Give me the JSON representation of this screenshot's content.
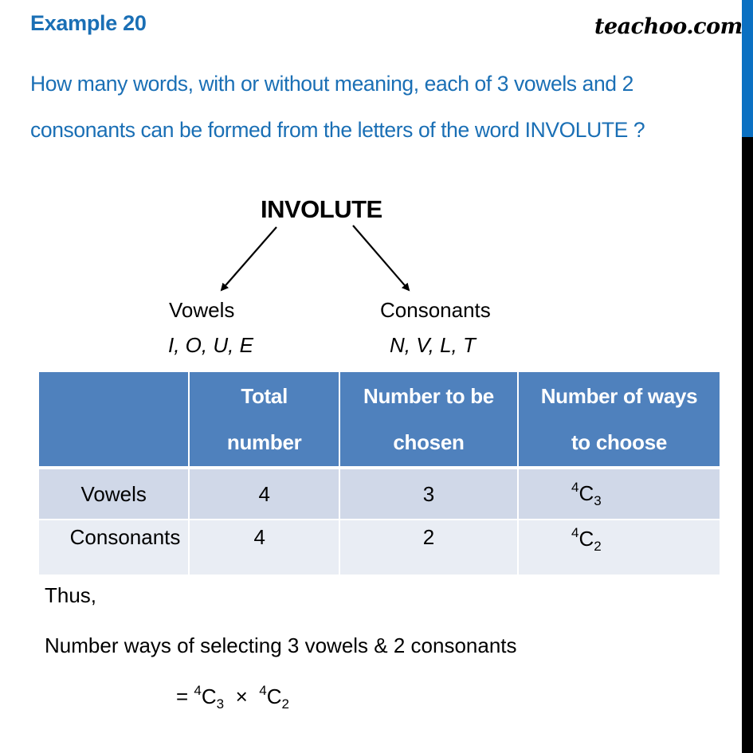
{
  "header": {
    "example_title": "Example 20",
    "brand": "teachoo.com"
  },
  "question": "How many words, with or without meaning, each of 3 vowels and 2 consonants can be formed from the letters of the word INVOLUTE ?",
  "diagram": {
    "root_word": "INVOLUTE",
    "left_branch": {
      "label": "Vowels",
      "letters": "I, O, U, E"
    },
    "right_branch": {
      "label": "Consonants",
      "letters": "N, V, L, T"
    }
  },
  "table": {
    "headers": [
      {
        "line1": "",
        "line2": ""
      },
      {
        "line1": "Total",
        "line2": "number"
      },
      {
        "line1": "Number to be",
        "line2": "chosen"
      },
      {
        "line1": "Number of ways",
        "line2": "to choose"
      }
    ],
    "rows": [
      {
        "label": "Vowels",
        "total": "4",
        "chosen": "3",
        "ways": {
          "n": "4",
          "symbol": "C",
          "r": "3"
        }
      },
      {
        "label": "Consonants",
        "total": "4",
        "chosen": "2",
        "ways": {
          "n": "4",
          "symbol": "C",
          "r": "2"
        }
      }
    ]
  },
  "solution": {
    "thus": "Thus,",
    "statement": "Number ways of selecting 3 vowels & 2 consonants",
    "formula": {
      "equals": "=",
      "term1": {
        "n": "4",
        "symbol": "C",
        "r": "3"
      },
      "operator": "×",
      "term2": {
        "n": "4",
        "symbol": "C",
        "r": "2"
      }
    }
  },
  "colors": {
    "title_blue": "#1a6fb5",
    "table_header": "#4f81bd",
    "table_row_odd": "#d0d8e8",
    "table_row_even": "#e9edf4",
    "side_bar_blue": "#0a70c2",
    "side_bar_black": "#000000"
  }
}
